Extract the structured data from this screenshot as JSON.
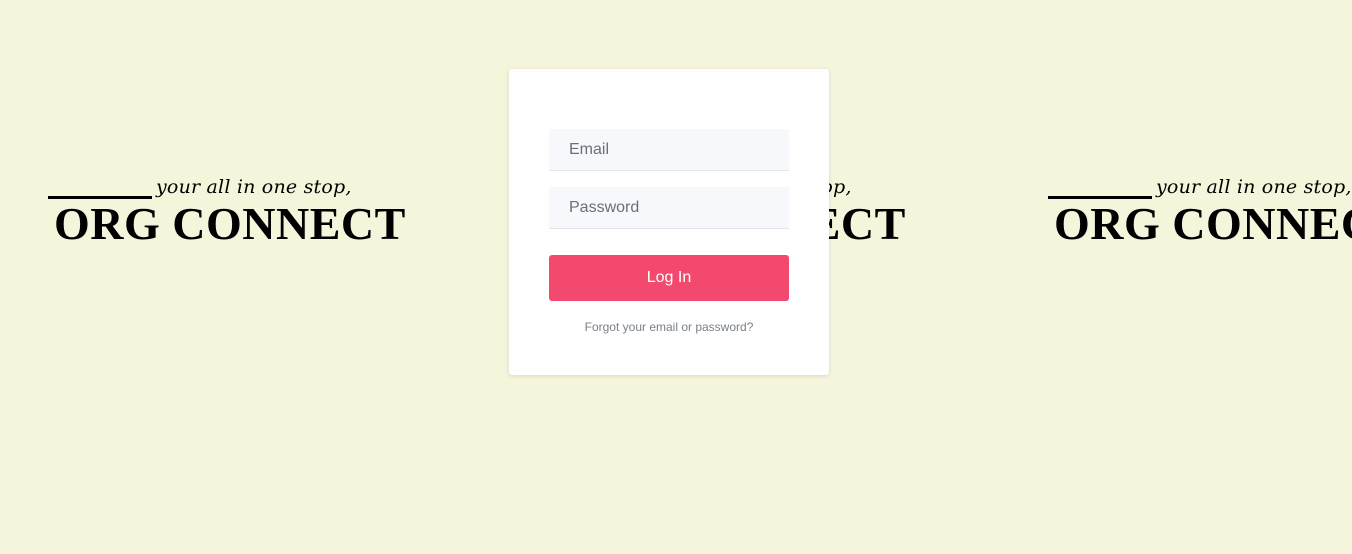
{
  "brand": {
    "tagline": "your all in one stop,",
    "name": "ORG CONNECT"
  },
  "login": {
    "email_placeholder": "Email",
    "password_placeholder": "Password",
    "submit_label": "Log In",
    "forgot_label": "Forgot your email or password?"
  },
  "colors": {
    "background": "#f5f5dc",
    "card": "#ffffff",
    "button": "#f4496e"
  }
}
